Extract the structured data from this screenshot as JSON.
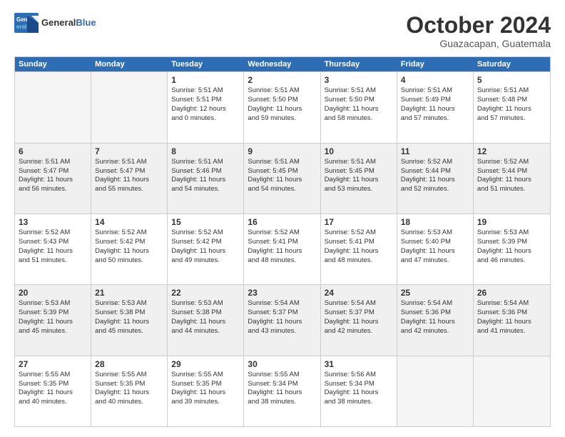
{
  "logo": {
    "general": "General",
    "blue": "Blue"
  },
  "title": "October 2024",
  "subtitle": "Guazacapan, Guatemala",
  "days": [
    "Sunday",
    "Monday",
    "Tuesday",
    "Wednesday",
    "Thursday",
    "Friday",
    "Saturday"
  ],
  "rows": [
    [
      {
        "day": "",
        "empty": true
      },
      {
        "day": "",
        "empty": true
      },
      {
        "day": "1",
        "line1": "Sunrise: 5:51 AM",
        "line2": "Sunset: 5:51 PM",
        "line3": "Daylight: 12 hours",
        "line4": "and 0 minutes."
      },
      {
        "day": "2",
        "line1": "Sunrise: 5:51 AM",
        "line2": "Sunset: 5:50 PM",
        "line3": "Daylight: 11 hours",
        "line4": "and 59 minutes."
      },
      {
        "day": "3",
        "line1": "Sunrise: 5:51 AM",
        "line2": "Sunset: 5:50 PM",
        "line3": "Daylight: 11 hours",
        "line4": "and 58 minutes."
      },
      {
        "day": "4",
        "line1": "Sunrise: 5:51 AM",
        "line2": "Sunset: 5:49 PM",
        "line3": "Daylight: 11 hours",
        "line4": "and 57 minutes."
      },
      {
        "day": "5",
        "line1": "Sunrise: 5:51 AM",
        "line2": "Sunset: 5:48 PM",
        "line3": "Daylight: 11 hours",
        "line4": "and 57 minutes."
      }
    ],
    [
      {
        "day": "6",
        "line1": "Sunrise: 5:51 AM",
        "line2": "Sunset: 5:47 PM",
        "line3": "Daylight: 11 hours",
        "line4": "and 56 minutes."
      },
      {
        "day": "7",
        "line1": "Sunrise: 5:51 AM",
        "line2": "Sunset: 5:47 PM",
        "line3": "Daylight: 11 hours",
        "line4": "and 55 minutes."
      },
      {
        "day": "8",
        "line1": "Sunrise: 5:51 AM",
        "line2": "Sunset: 5:46 PM",
        "line3": "Daylight: 11 hours",
        "line4": "and 54 minutes."
      },
      {
        "day": "9",
        "line1": "Sunrise: 5:51 AM",
        "line2": "Sunset: 5:45 PM",
        "line3": "Daylight: 11 hours",
        "line4": "and 54 minutes."
      },
      {
        "day": "10",
        "line1": "Sunrise: 5:51 AM",
        "line2": "Sunset: 5:45 PM",
        "line3": "Daylight: 11 hours",
        "line4": "and 53 minutes."
      },
      {
        "day": "11",
        "line1": "Sunrise: 5:52 AM",
        "line2": "Sunset: 5:44 PM",
        "line3": "Daylight: 11 hours",
        "line4": "and 52 minutes."
      },
      {
        "day": "12",
        "line1": "Sunrise: 5:52 AM",
        "line2": "Sunset: 5:44 PM",
        "line3": "Daylight: 11 hours",
        "line4": "and 51 minutes."
      }
    ],
    [
      {
        "day": "13",
        "line1": "Sunrise: 5:52 AM",
        "line2": "Sunset: 5:43 PM",
        "line3": "Daylight: 11 hours",
        "line4": "and 51 minutes."
      },
      {
        "day": "14",
        "line1": "Sunrise: 5:52 AM",
        "line2": "Sunset: 5:42 PM",
        "line3": "Daylight: 11 hours",
        "line4": "and 50 minutes."
      },
      {
        "day": "15",
        "line1": "Sunrise: 5:52 AM",
        "line2": "Sunset: 5:42 PM",
        "line3": "Daylight: 11 hours",
        "line4": "and 49 minutes."
      },
      {
        "day": "16",
        "line1": "Sunrise: 5:52 AM",
        "line2": "Sunset: 5:41 PM",
        "line3": "Daylight: 11 hours",
        "line4": "and 48 minutes."
      },
      {
        "day": "17",
        "line1": "Sunrise: 5:52 AM",
        "line2": "Sunset: 5:41 PM",
        "line3": "Daylight: 11 hours",
        "line4": "and 48 minutes."
      },
      {
        "day": "18",
        "line1": "Sunrise: 5:53 AM",
        "line2": "Sunset: 5:40 PM",
        "line3": "Daylight: 11 hours",
        "line4": "and 47 minutes."
      },
      {
        "day": "19",
        "line1": "Sunrise: 5:53 AM",
        "line2": "Sunset: 5:39 PM",
        "line3": "Daylight: 11 hours",
        "line4": "and 46 minutes."
      }
    ],
    [
      {
        "day": "20",
        "line1": "Sunrise: 5:53 AM",
        "line2": "Sunset: 5:39 PM",
        "line3": "Daylight: 11 hours",
        "line4": "and 45 minutes."
      },
      {
        "day": "21",
        "line1": "Sunrise: 5:53 AM",
        "line2": "Sunset: 5:38 PM",
        "line3": "Daylight: 11 hours",
        "line4": "and 45 minutes."
      },
      {
        "day": "22",
        "line1": "Sunrise: 5:53 AM",
        "line2": "Sunset: 5:38 PM",
        "line3": "Daylight: 11 hours",
        "line4": "and 44 minutes."
      },
      {
        "day": "23",
        "line1": "Sunrise: 5:54 AM",
        "line2": "Sunset: 5:37 PM",
        "line3": "Daylight: 11 hours",
        "line4": "and 43 minutes."
      },
      {
        "day": "24",
        "line1": "Sunrise: 5:54 AM",
        "line2": "Sunset: 5:37 PM",
        "line3": "Daylight: 11 hours",
        "line4": "and 42 minutes."
      },
      {
        "day": "25",
        "line1": "Sunrise: 5:54 AM",
        "line2": "Sunset: 5:36 PM",
        "line3": "Daylight: 11 hours",
        "line4": "and 42 minutes."
      },
      {
        "day": "26",
        "line1": "Sunrise: 5:54 AM",
        "line2": "Sunset: 5:36 PM",
        "line3": "Daylight: 11 hours",
        "line4": "and 41 minutes."
      }
    ],
    [
      {
        "day": "27",
        "line1": "Sunrise: 5:55 AM",
        "line2": "Sunset: 5:35 PM",
        "line3": "Daylight: 11 hours",
        "line4": "and 40 minutes."
      },
      {
        "day": "28",
        "line1": "Sunrise: 5:55 AM",
        "line2": "Sunset: 5:35 PM",
        "line3": "Daylight: 11 hours",
        "line4": "and 40 minutes."
      },
      {
        "day": "29",
        "line1": "Sunrise: 5:55 AM",
        "line2": "Sunset: 5:35 PM",
        "line3": "Daylight: 11 hours",
        "line4": "and 39 minutes."
      },
      {
        "day": "30",
        "line1": "Sunrise: 5:55 AM",
        "line2": "Sunset: 5:34 PM",
        "line3": "Daylight: 11 hours",
        "line4": "and 38 minutes."
      },
      {
        "day": "31",
        "line1": "Sunrise: 5:56 AM",
        "line2": "Sunset: 5:34 PM",
        "line3": "Daylight: 11 hours",
        "line4": "and 38 minutes."
      },
      {
        "day": "",
        "empty": true
      },
      {
        "day": "",
        "empty": true
      }
    ]
  ]
}
